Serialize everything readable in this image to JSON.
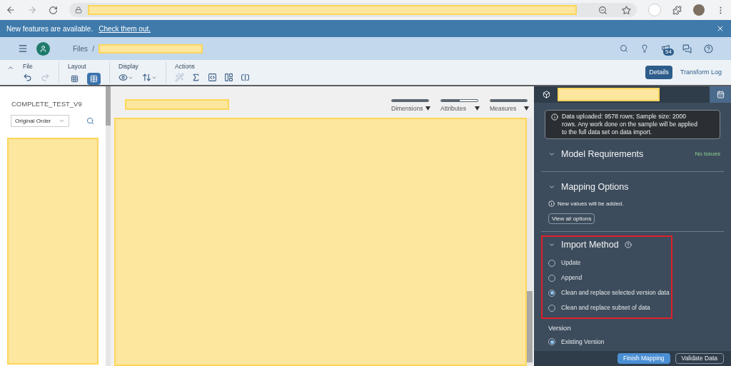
{
  "banner": {
    "message": "New features are available.",
    "link": "Check them out."
  },
  "shell": {
    "breadcrumb": [
      "Files",
      "/"
    ],
    "notification_badge": "54"
  },
  "toolbar": {
    "groups": [
      {
        "label": "File",
        "kind": "file"
      },
      {
        "label": "Layout",
        "kind": "layout",
        "options": [
          {
            "selected": false
          },
          {
            "selected": true
          }
        ]
      },
      {
        "label": "Display",
        "kind": "display"
      },
      {
        "label": "Actions",
        "kind": "actions"
      }
    ],
    "view_tabs": [
      {
        "label": "Details",
        "selected": true
      },
      {
        "label": "Transform Log",
        "selected": false
      }
    ]
  },
  "left_panel": {
    "title": "COMPLETE_TEST_V9",
    "sort_select": {
      "value": "Original Order"
    }
  },
  "center": {
    "column_filters": [
      {
        "label": "Dimensions",
        "level": 1
      },
      {
        "label": "Attributes",
        "level": 0.5
      },
      {
        "label": "Measures",
        "level": 1
      }
    ]
  },
  "right_panel": {
    "info": "Data uploaded: 9578 rows; Sample size: 2000 rows. Any work done on the sample will be applied to the full data set on data import.",
    "sections": [
      {
        "title": "Model Requirements",
        "expanded": true,
        "highlighted": false,
        "status": "No Issues"
      },
      {
        "title": "Mapping Options",
        "expanded": true,
        "highlighted": false,
        "note": "New values will be added.",
        "button": "View all options"
      },
      {
        "title": "Import Method",
        "expanded": true,
        "highlighted": true,
        "help": true,
        "options": [
          {
            "label": "Update",
            "selected": false
          },
          {
            "label": "Append",
            "selected": false
          },
          {
            "label": "Clean and replace selected version data",
            "selected": true
          },
          {
            "label": "Clean and replace subset of data",
            "selected": false
          }
        ]
      }
    ],
    "version": {
      "label": "Version",
      "options": [
        {
          "label": "Existing Version",
          "selected": true
        }
      ]
    },
    "footer_buttons": [
      {
        "label": "Finish Mapping",
        "kind": "primary"
      },
      {
        "label": "Validate Data",
        "kind": "secondary"
      }
    ]
  }
}
